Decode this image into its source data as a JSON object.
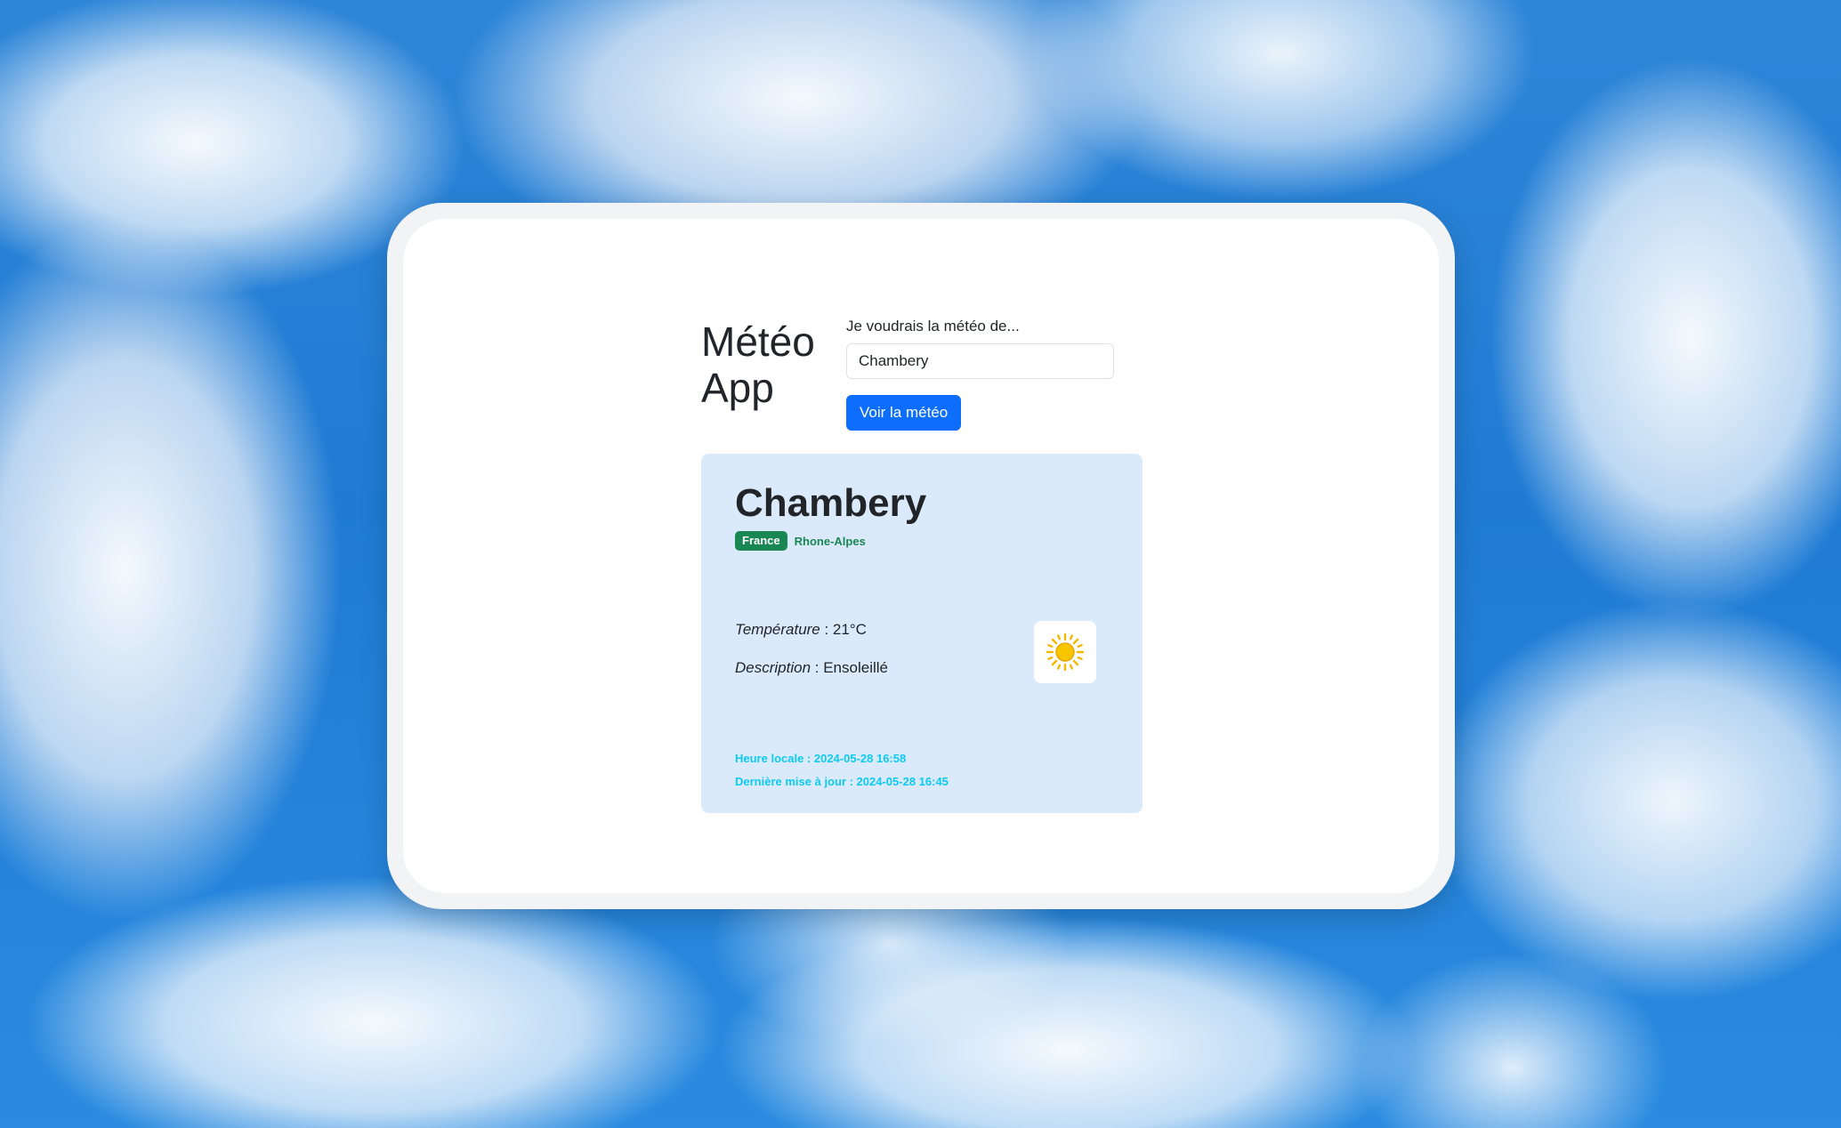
{
  "app": {
    "title_line1": "Météo",
    "title_line2": "App"
  },
  "search": {
    "label": "Je voudrais la météo de...",
    "value": "Chambery",
    "button_label": "Voir la météo"
  },
  "weather": {
    "city": "Chambery",
    "country": "France",
    "region": "Rhone-Alpes",
    "temperature_label": "Température",
    "temperature_value": " : 21°C",
    "description_label": "Description",
    "description_value": " : Ensoleillé",
    "icon": "sun-icon",
    "local_time": "Heure locale : 2024-05-28 16:58",
    "last_update": "Dernière mise à jour : 2024-05-28 16:45"
  },
  "colors": {
    "primary_button": "#0d6efd",
    "card_background": "#dbeafa",
    "badge_success": "#198754",
    "info_text": "#0dcaf0",
    "sun": "#f5b800"
  }
}
